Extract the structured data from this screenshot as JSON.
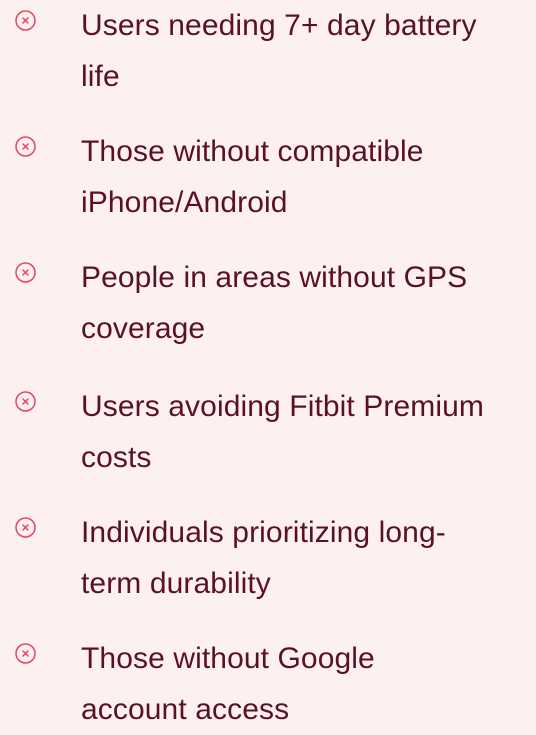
{
  "items": [
    {
      "line1": "Users needing 7+ day battery",
      "line2": "life",
      "icon": "x-circle-icon"
    },
    {
      "line1": "Those without compatible",
      "line2": "iPhone/Android",
      "icon": "x-circle-icon"
    },
    {
      "line1": "People in areas without GPS",
      "line2": "coverage",
      "icon": "x-circle-icon"
    },
    {
      "line1": "Users avoiding Fitbit Premium",
      "line2": "costs",
      "icon": "x-circle-icon"
    },
    {
      "line1": "Individuals prioritizing long-",
      "line2": "term durability",
      "icon": "x-circle-icon"
    },
    {
      "line1": "Those without Google",
      "line2": "account access",
      "icon": "x-circle-icon"
    }
  ],
  "colors": {
    "background": "#fdf0f1",
    "text": "#5a1124",
    "icon": "#e8445f"
  }
}
